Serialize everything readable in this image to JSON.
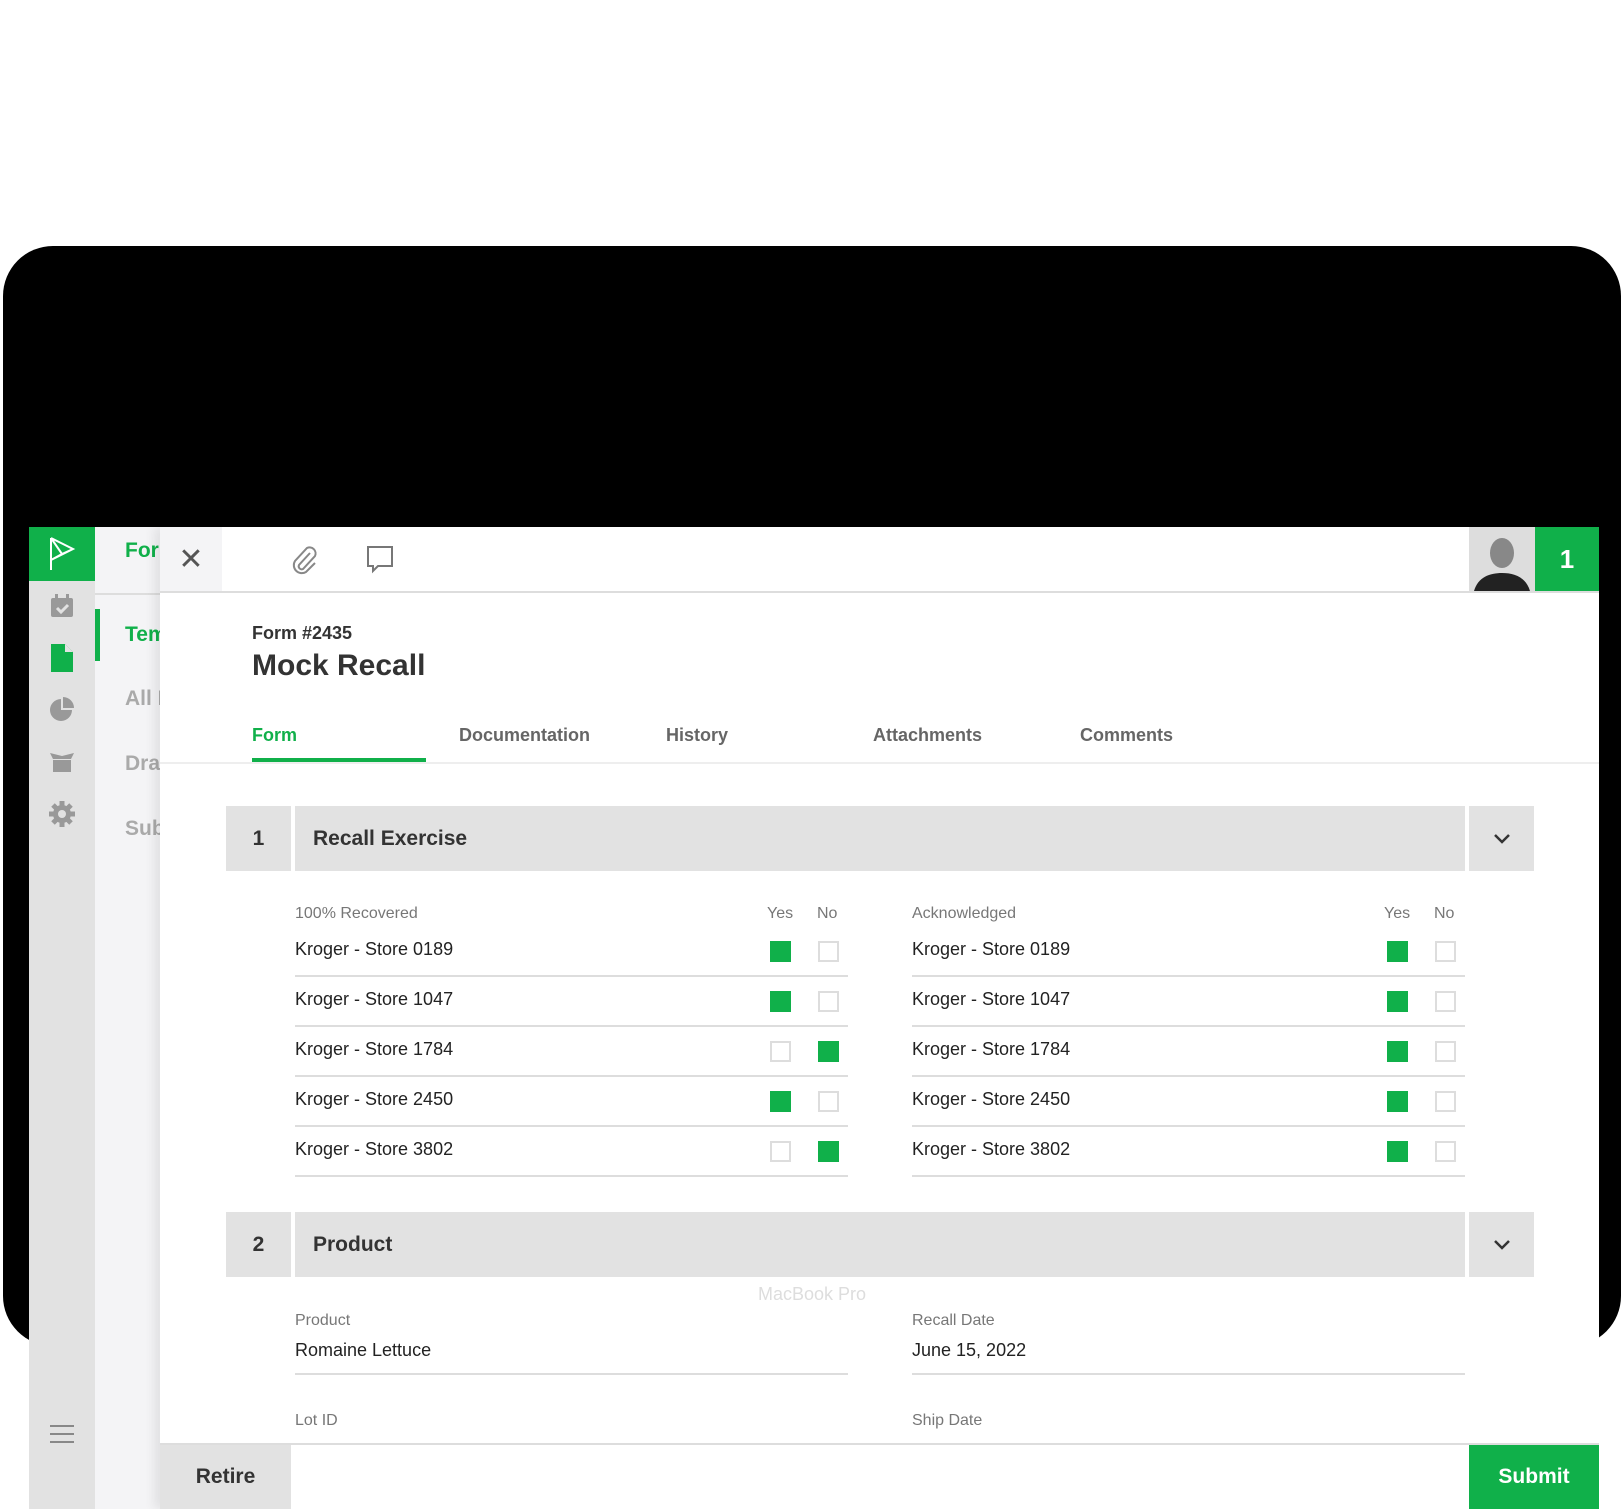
{
  "device_label": "MacBook Pro",
  "secondary_nav": {
    "header": "Forms",
    "items": [
      "Templates",
      "All Forms",
      "Drafts",
      "Submitted"
    ]
  },
  "header": {
    "notification_count": "1"
  },
  "form": {
    "number": "Form #2435",
    "title": "Mock Recall"
  },
  "tabs": [
    "Form",
    "Documentation",
    "History",
    "Attachments",
    "Comments"
  ],
  "active_tab": "Form",
  "sections": [
    {
      "number": "1",
      "title": "Recall Exercise",
      "left": {
        "label": "100% Recovered",
        "yes": "Yes",
        "no": "No",
        "rows": [
          {
            "name": "Kroger - Store 0189",
            "value": "yes"
          },
          {
            "name": "Kroger - Store 1047",
            "value": "yes"
          },
          {
            "name": "Kroger - Store 1784",
            "value": "no"
          },
          {
            "name": "Kroger - Store 2450",
            "value": "yes"
          },
          {
            "name": "Kroger - Store 3802",
            "value": "no"
          }
        ]
      },
      "right": {
        "label": "Acknowledged",
        "yes": "Yes",
        "no": "No",
        "rows": [
          {
            "name": "Kroger - Store 0189",
            "value": "yes"
          },
          {
            "name": "Kroger - Store 1047",
            "value": "yes"
          },
          {
            "name": "Kroger - Store 1784",
            "value": "yes"
          },
          {
            "name": "Kroger - Store 2450",
            "value": "yes"
          },
          {
            "name": "Kroger - Store 3802",
            "value": "yes"
          }
        ]
      }
    },
    {
      "number": "2",
      "title": "Product",
      "fields": [
        {
          "label": "Product",
          "value": "Romaine Lettuce"
        },
        {
          "label": "Recall Date",
          "value": "June 15, 2022"
        },
        {
          "label": "Lot ID",
          "value": ""
        },
        {
          "label": "Ship Date",
          "value": ""
        }
      ]
    }
  ],
  "footer": {
    "retire": "Retire",
    "submit": "Submit"
  },
  "colors": {
    "accent": "#10b04a",
    "panel": "#e2e2e2"
  }
}
